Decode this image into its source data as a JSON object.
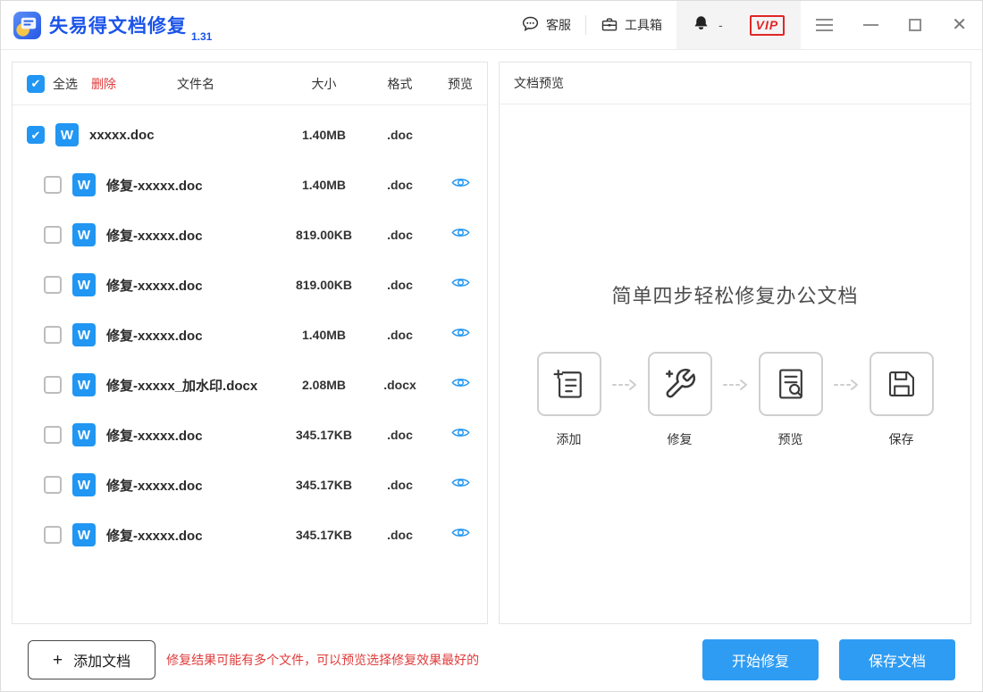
{
  "header": {
    "title": "失易得文档修复",
    "version": "1.31",
    "customer_service": "客服",
    "toolbox": "工具箱",
    "account_text": "-",
    "vip_label": "VIP"
  },
  "file_panel": {
    "select_all_label": "全选",
    "select_all_checked": true,
    "delete_label": "删除",
    "columns": {
      "name": "文件名",
      "size": "大小",
      "format": "格式",
      "preview": "预览"
    },
    "rows": [
      {
        "name": "xxxxx.doc",
        "size": "1.40MB",
        "format": ".doc",
        "checked": true,
        "has_preview": false,
        "indent": false
      },
      {
        "name": "修复-xxxxx.doc",
        "size": "1.40MB",
        "format": ".doc",
        "checked": false,
        "has_preview": true,
        "indent": true
      },
      {
        "name": "修复-xxxxx.doc",
        "size": "819.00KB",
        "format": ".doc",
        "checked": false,
        "has_preview": true,
        "indent": true
      },
      {
        "name": "修复-xxxxx.doc",
        "size": "819.00KB",
        "format": ".doc",
        "checked": false,
        "has_preview": true,
        "indent": true
      },
      {
        "name": "修复-xxxxx.doc",
        "size": "1.40MB",
        "format": ".doc",
        "checked": false,
        "has_preview": true,
        "indent": true
      },
      {
        "name": "修复-xxxxx_加水印.docx",
        "size": "2.08MB",
        "format": ".docx",
        "checked": false,
        "has_preview": true,
        "indent": true
      },
      {
        "name": "修复-xxxxx.doc",
        "size": "345.17KB",
        "format": ".doc",
        "checked": false,
        "has_preview": true,
        "indent": true
      },
      {
        "name": "修复-xxxxx.doc",
        "size": "345.17KB",
        "format": ".doc",
        "checked": false,
        "has_preview": true,
        "indent": true
      },
      {
        "name": "修复-xxxxx.doc",
        "size": "345.17KB",
        "format": ".doc",
        "checked": false,
        "has_preview": true,
        "indent": true
      }
    ]
  },
  "preview_panel": {
    "header": "文档预览",
    "headline": "简单四步轻松修复办公文档",
    "steps": [
      {
        "label": "添加",
        "icon": "add-document-icon"
      },
      {
        "label": "修复",
        "icon": "repair-icon"
      },
      {
        "label": "预览",
        "icon": "preview-document-icon"
      },
      {
        "label": "保存",
        "icon": "save-icon"
      }
    ]
  },
  "footer": {
    "add_document_label": "添加文档",
    "note": "修复结果可能有多个文件，可以预览选择修复效果最好的",
    "start_repair_label": "开始修复",
    "save_document_label": "保存文档"
  },
  "colors": {
    "title_blue": "#1b54ea",
    "accent_blue": "#2f9cf3",
    "word_icon_blue": "#2196f3",
    "alert_red": "#e03b3b",
    "vip_red": "#e12626"
  }
}
